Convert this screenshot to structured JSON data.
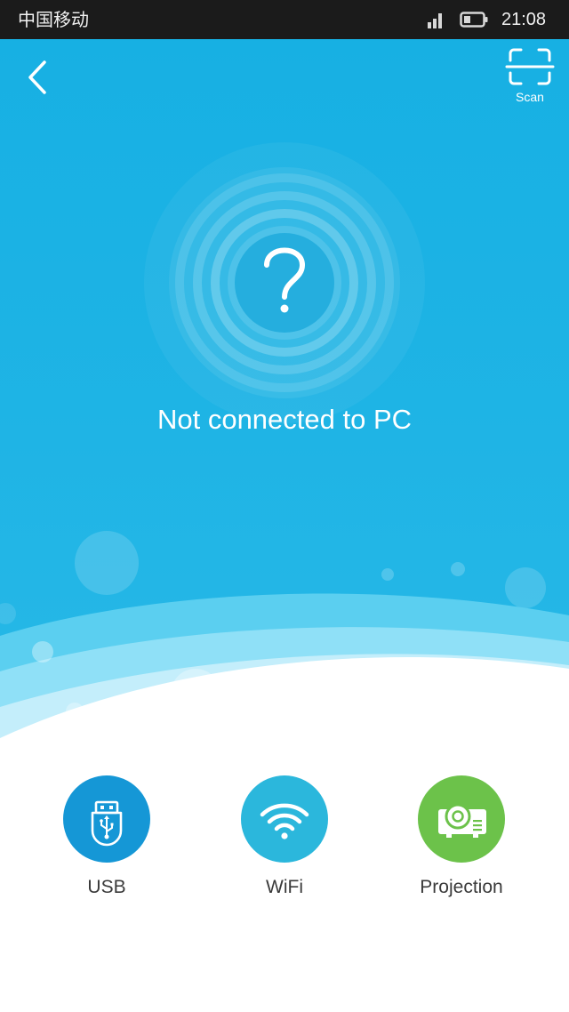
{
  "status_bar": {
    "carrier": "中国移动",
    "time": "21:08"
  },
  "header": {
    "back_icon": "chevron-left-icon",
    "scan_icon": "scan-frame-icon",
    "scan_label": "Scan"
  },
  "connection_status": {
    "icon": "question-mark-icon",
    "text": "Not connected to PC"
  },
  "options": [
    {
      "label": "USB",
      "icon": "usb-drive-icon",
      "color": "#1597d6"
    },
    {
      "label": "WiFi",
      "icon": "wifi-icon",
      "color": "#2bb7dc"
    },
    {
      "label": "Projection",
      "icon": "projector-icon",
      "color": "#6cc24a"
    }
  ],
  "colors": {
    "header_blue": "#1fb4e5",
    "status_bar": "#1b1b1b"
  }
}
